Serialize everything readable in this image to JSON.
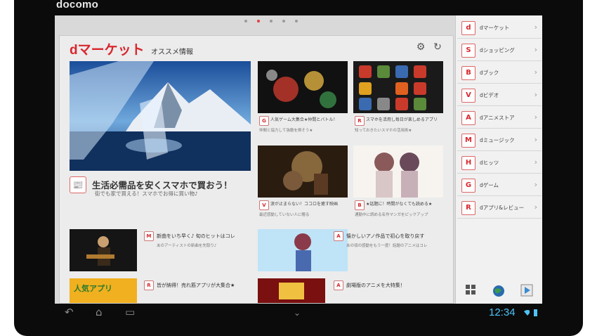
{
  "device": {
    "brand": "docomo"
  },
  "home": {
    "page_dots": 5,
    "active_dot": 1
  },
  "widget": {
    "logo": "dマーケット",
    "subtitle": "オススメ情報",
    "settings_icon": "gear-icon",
    "refresh_icon": "refresh-icon",
    "feature": {
      "title": "生活必需品を安くスマホで買おう！",
      "subtitle": "街でも家で買える！スマホでお得に買い物♪"
    },
    "tiles": [
      {
        "caption": "人気ゲーム大集合★仲間とバトル！",
        "caption2": "仲間と協力して強敵を倒そう★"
      },
      {
        "caption": "スマホを活用し毎日が楽しめるアプリ",
        "caption2": "知っておきたいスマホの活用術★"
      },
      {
        "caption": "涙が止まらない！ココロを癒す映画",
        "caption2": "最近感動していない人に贈る"
      },
      {
        "caption": "★話題に！時間がなくても読める★",
        "caption2": "通勤中に読める名作マンガをピックアップ"
      }
    ],
    "rows": [
      {
        "title": "新曲をいち早く♪ 旬のヒットはコレ",
        "subtitle": "あのアーティストの新曲を先取り♪"
      },
      {
        "title": "懐かしいアノ作品で初心を取り戻す",
        "subtitle": "あの頃の感動をもう一度！話題のアニメはコレ"
      },
      {
        "title": "皆が納得！売れ筋アプリが大集合★",
        "subtitle": ""
      },
      {
        "title": "劇場版のアニメを大特集！",
        "subtitle": ""
      }
    ],
    "row_banner_text": "人気アプリ"
  },
  "sidebar": {
    "items": [
      {
        "label": "dマーケット",
        "icon": "d"
      },
      {
        "label": "dショッピング",
        "icon": "S"
      },
      {
        "label": "dブック",
        "icon": "B"
      },
      {
        "label": "dビデオ",
        "icon": "V"
      },
      {
        "label": "dアニメストア",
        "icon": "A"
      },
      {
        "label": "dミュージック",
        "icon": "M"
      },
      {
        "label": "dヒッツ",
        "icon": "H"
      },
      {
        "label": "dゲーム",
        "icon": "G"
      },
      {
        "label": "dアプリ&レビュー",
        "icon": "R"
      }
    ],
    "bottom_icons": [
      "apps-grid-icon",
      "globe-icon",
      "play-store-icon"
    ]
  },
  "navbar": {
    "time": "12:34"
  },
  "colors": {
    "accent": "#d9262d",
    "clock": "#4fc3f7",
    "bezel": "#0b0b0b"
  }
}
